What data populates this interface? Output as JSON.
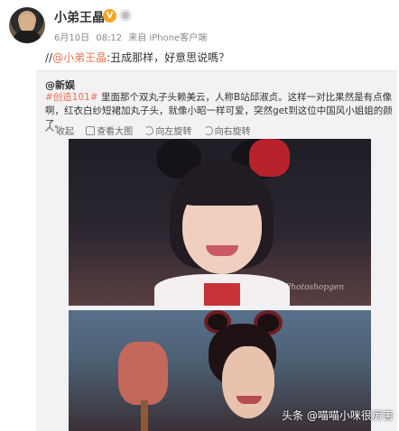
{
  "post": {
    "username": "小弟王晶",
    "verified_badge": "V",
    "meta": {
      "date": "6月10日",
      "time": "08:12",
      "source": "来自 iPhone客户端"
    },
    "reply_prefix": "//",
    "reply_mention": "@小弟王晶",
    "reply_text": ":丑成那样，好意思说嗎？"
  },
  "repost": {
    "author": "@新娱",
    "hashtag": "#创造101#",
    "text": " 里面那个双丸子头赖美云，人称B站邱淑贞。这样一对比果然是有点像啊，红衣白纱短裙加丸子头，就像小昭一样可爱，突然get到这位中国风小姐姐的颜了。",
    "toolbar": {
      "collapse": "收起",
      "view_large": "查看大图",
      "rotate_left": "向左旋转",
      "rotate_right": "向右旋转"
    },
    "image_watermark": "Photoshopgen"
  },
  "footer": {
    "source_badge": "头条 @喵喵小咪很厉害"
  },
  "colors": {
    "accent": "#eb7350",
    "repost_bg": "#f2f2f5"
  }
}
